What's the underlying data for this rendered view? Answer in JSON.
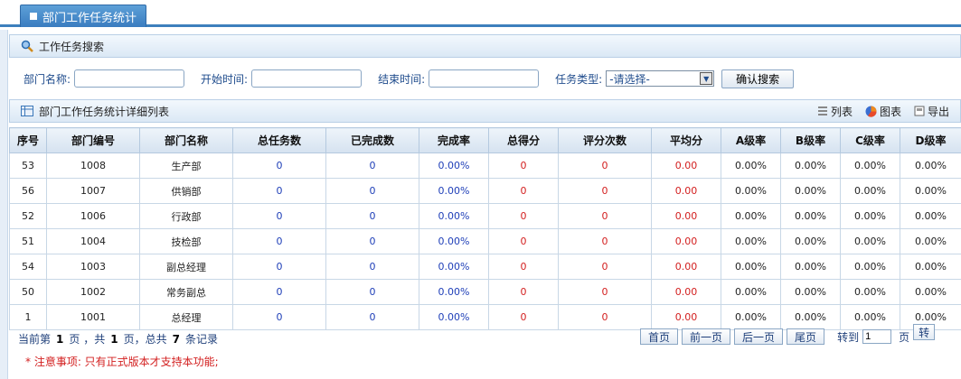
{
  "tab": {
    "title": "部门工作任务统计"
  },
  "search_section": {
    "title": "工作任务搜索"
  },
  "search": {
    "dept_label": "部门名称:",
    "dept_value": "",
    "start_label": "开始时间:",
    "start_value": "",
    "end_label": "结束时间:",
    "end_value": "",
    "type_label": "任务类型:",
    "type_selected": "-请选择-",
    "submit": "确认搜索"
  },
  "list_section": {
    "title": "部门工作任务统计详细列表",
    "tools": {
      "list": "列表",
      "chart": "图表",
      "export": "导出"
    }
  },
  "table": {
    "headers": [
      "序号",
      "部门编号",
      "部门名称",
      "总任务数",
      "已完成数",
      "完成率",
      "总得分",
      "评分次数",
      "平均分",
      "A级率",
      "B级率",
      "C级率",
      "D级率"
    ],
    "rows": [
      [
        "53",
        "1008",
        "生产部",
        "0",
        "0",
        "0.00%",
        "0",
        "0",
        "0.00",
        "0.00%",
        "0.00%",
        "0.00%",
        "0.00%"
      ],
      [
        "56",
        "1007",
        "供销部",
        "0",
        "0",
        "0.00%",
        "0",
        "0",
        "0.00",
        "0.00%",
        "0.00%",
        "0.00%",
        "0.00%"
      ],
      [
        "52",
        "1006",
        "行政部",
        "0",
        "0",
        "0.00%",
        "0",
        "0",
        "0.00",
        "0.00%",
        "0.00%",
        "0.00%",
        "0.00%"
      ],
      [
        "51",
        "1004",
        "技检部",
        "0",
        "0",
        "0.00%",
        "0",
        "0",
        "0.00",
        "0.00%",
        "0.00%",
        "0.00%",
        "0.00%"
      ],
      [
        "54",
        "1003",
        "副总经理",
        "0",
        "0",
        "0.00%",
        "0",
        "0",
        "0.00",
        "0.00%",
        "0.00%",
        "0.00%",
        "0.00%"
      ],
      [
        "50",
        "1002",
        "常务副总",
        "0",
        "0",
        "0.00%",
        "0",
        "0",
        "0.00",
        "0.00%",
        "0.00%",
        "0.00%",
        "0.00%"
      ],
      [
        "1",
        "1001",
        "总经理",
        "0",
        "0",
        "0.00%",
        "0",
        "0",
        "0.00",
        "0.00%",
        "0.00%",
        "0.00%",
        "0.00%"
      ]
    ]
  },
  "pager": {
    "prefix": "当前第",
    "current": "1",
    "mid": "页 ，共",
    "total_pages": "1",
    "suffix1": "页，总共",
    "total_records": "7",
    "suffix2": "条记录",
    "first": "首页",
    "prev": "前一页",
    "next": "后一页",
    "last": "尾页",
    "goto_label": "转到",
    "goto_value": "1",
    "page_unit": "页",
    "go": "转"
  },
  "note": {
    "star": "*",
    "text": "注意事项:  只有正式版本才支持本功能;"
  },
  "colors": {
    "blue": "#1f3fb8",
    "red": "#d32020",
    "accent": "#3d80bd"
  }
}
